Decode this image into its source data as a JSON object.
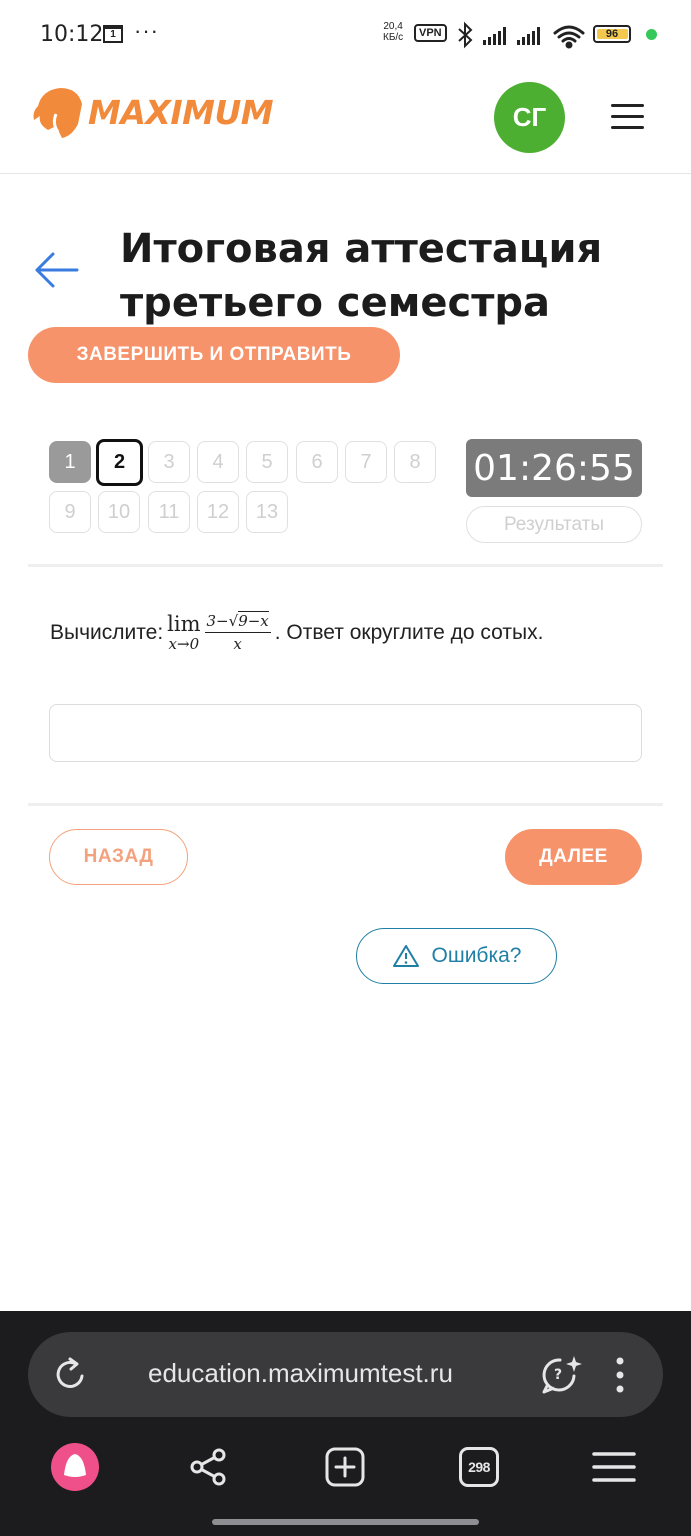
{
  "status_bar": {
    "time": "10:12",
    "calendar_day": "1",
    "dots": "···",
    "speed_value": "20,4",
    "speed_unit": "КБ/с",
    "vpn": "VPN",
    "battery": "96"
  },
  "header": {
    "logo": "MAXIMUM",
    "avatar_initials": "СГ"
  },
  "page": {
    "title": "Итоговая аттестация третьего семестра",
    "finish_button": "ЗАВЕРШИТЬ И ОТПРАВИТЬ"
  },
  "question_nav": {
    "items": [
      {
        "label": "1",
        "state": "done"
      },
      {
        "label": "2",
        "state": "current"
      },
      {
        "label": "3",
        "state": "pending"
      },
      {
        "label": "4",
        "state": "pending"
      },
      {
        "label": "5",
        "state": "pending"
      },
      {
        "label": "6",
        "state": "pending"
      },
      {
        "label": "7",
        "state": "pending"
      },
      {
        "label": "8",
        "state": "pending"
      },
      {
        "label": "9",
        "state": "pending"
      },
      {
        "label": "10",
        "state": "pending"
      },
      {
        "label": "11",
        "state": "pending"
      },
      {
        "label": "12",
        "state": "pending"
      },
      {
        "label": "13",
        "state": "pending"
      }
    ],
    "timer": "01:26:55",
    "results_button": "Результаты"
  },
  "question": {
    "prefix": "Вычислите:",
    "lim_word": "lim",
    "lim_sub": "x→0",
    "numerator_pre": "3−√",
    "numerator_rad": "9−x",
    "denominator": "x",
    "suffix": ". Ответ округлите до сотых.",
    "answer_value": "",
    "answer_placeholder": ""
  },
  "navigation": {
    "back": "НАЗАД",
    "next": "ДАЛЕЕ",
    "error": "Ошибка?"
  },
  "browser": {
    "url": "education.maximumtest.ru",
    "tabs_count": "298"
  },
  "colors": {
    "accent": "#f7936b",
    "avatar": "#4caf32",
    "link": "#1f7fa5",
    "timer_bg": "#7b7b7b"
  }
}
